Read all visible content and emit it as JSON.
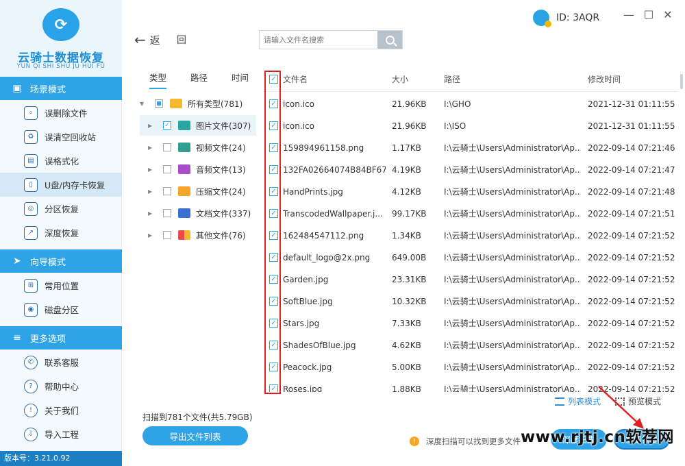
{
  "app": {
    "logo_title": "云骑士数据恢复",
    "logo_sub": "YUN QI SHI SHU JU HUI FU",
    "user_id": "ID: 3AQR",
    "version": "版本号：3.21.0.92"
  },
  "sidebar": {
    "sections": [
      {
        "title": "场景模式",
        "items": [
          "误删除文件",
          "误清空回收站",
          "误格式化",
          "U盘/内存卡恢复",
          "分区恢复",
          "深度恢复"
        ]
      },
      {
        "title": "向导模式",
        "items": [
          "常用位置",
          "磁盘分区"
        ]
      },
      {
        "title": "更多选项",
        "items": [
          "联系客服",
          "帮助中心",
          "关于我们",
          "导入工程"
        ]
      }
    ]
  },
  "topbar": {
    "back_label": "返",
    "back_label2": "回",
    "search_placeholder": "请输入文件名搜索"
  },
  "filter": {
    "tabs": [
      "类型",
      "路径",
      "时间"
    ],
    "tree": [
      {
        "label": "所有类型(781)",
        "state": "partial"
      },
      {
        "label": "图片文件(307)",
        "state": "checked"
      },
      {
        "label": "视频文件(24)",
        "state": "unchecked"
      },
      {
        "label": "音频文件(13)",
        "state": "unchecked"
      },
      {
        "label": "压缩文件(24)",
        "state": "unchecked"
      },
      {
        "label": "文档文件(337)",
        "state": "unchecked"
      },
      {
        "label": "其他文件(76)",
        "state": "unchecked"
      }
    ],
    "scan_info": "扫描到781个文件(共5.79GB)",
    "export_label": "导出文件列表"
  },
  "table": {
    "headers": {
      "name": "文件名",
      "size": "大小",
      "path": "路径",
      "mtime": "修改时间"
    },
    "rows": [
      {
        "name": "icon.ico",
        "size": "21.96KB",
        "path": "I:\\GHO",
        "mtime": "2021-12-31 01:11:55"
      },
      {
        "name": "icon.ico",
        "size": "21.96KB",
        "path": "I:\\ISO",
        "mtime": "2021-12-31 01:11:55"
      },
      {
        "name": "159894961158.png",
        "size": "1.17KB",
        "path": "I:\\云骑士\\Users\\Administrator\\Ap...",
        "mtime": "2022-09-14 07:21:46"
      },
      {
        "name": "132FA02664074B84BF67...",
        "size": "4.19KB",
        "path": "I:\\云骑士\\Users\\Administrator\\Ap...",
        "mtime": "2022-09-14 07:21:47"
      },
      {
        "name": "HandPrints.jpg",
        "size": "4.12KB",
        "path": "I:\\云骑士\\Users\\Administrator\\Ap...",
        "mtime": "2022-09-14 07:21:48"
      },
      {
        "name": "TranscodedWallpaper.j...",
        "size": "99.17KB",
        "path": "I:\\云骑士\\Users\\Administrator\\Ap...",
        "mtime": "2022-09-14 07:21:51"
      },
      {
        "name": "162484547112.png",
        "size": "1.34KB",
        "path": "I:\\云骑士\\Users\\Administrator\\Ap...",
        "mtime": "2022-09-14 07:21:52"
      },
      {
        "name": "default_logo@2x.png",
        "size": "649.00B",
        "path": "I:\\云骑士\\Users\\Administrator\\Ap...",
        "mtime": "2022-09-14 07:21:52"
      },
      {
        "name": "Garden.jpg",
        "size": "23.31KB",
        "path": "I:\\云骑士\\Users\\Administrator\\Ap...",
        "mtime": "2022-09-14 07:21:52"
      },
      {
        "name": "SoftBlue.jpg",
        "size": "10.32KB",
        "path": "I:\\云骑士\\Users\\Administrator\\Ap...",
        "mtime": "2022-09-14 07:21:52"
      },
      {
        "name": "Stars.jpg",
        "size": "7.33KB",
        "path": "I:\\云骑士\\Users\\Administrator\\Ap...",
        "mtime": "2022-09-14 07:21:52"
      },
      {
        "name": "ShadesOfBlue.jpg",
        "size": "4.62KB",
        "path": "I:\\云骑士\\Users\\Administrator\\Ap...",
        "mtime": "2022-09-14 07:21:52"
      },
      {
        "name": "Peacock.jpg",
        "size": "5.00KB",
        "path": "I:\\云骑士\\Users\\Administrator\\Ap...",
        "mtime": "2022-09-14 07:21:52"
      },
      {
        "name": "Roses.jpg",
        "size": "1.88KB",
        "path": "I:\\云骑士\\Users\\Administrator\\Ap...",
        "mtime": "2022-09-14 07:21:52"
      }
    ]
  },
  "footer": {
    "list_mode": "列表模式",
    "preview_mode": "预览模式",
    "hint": "深度扫描可以找到更多文件",
    "deep_scan_label": "深度扫描",
    "recover_label": "立即恢复",
    "watermark": "www.rjtj.cn软荐网"
  },
  "colors": {
    "accent": "#2ea3e6",
    "highlight": "#e02020",
    "sidebar_bg": "#f3f9fd"
  }
}
